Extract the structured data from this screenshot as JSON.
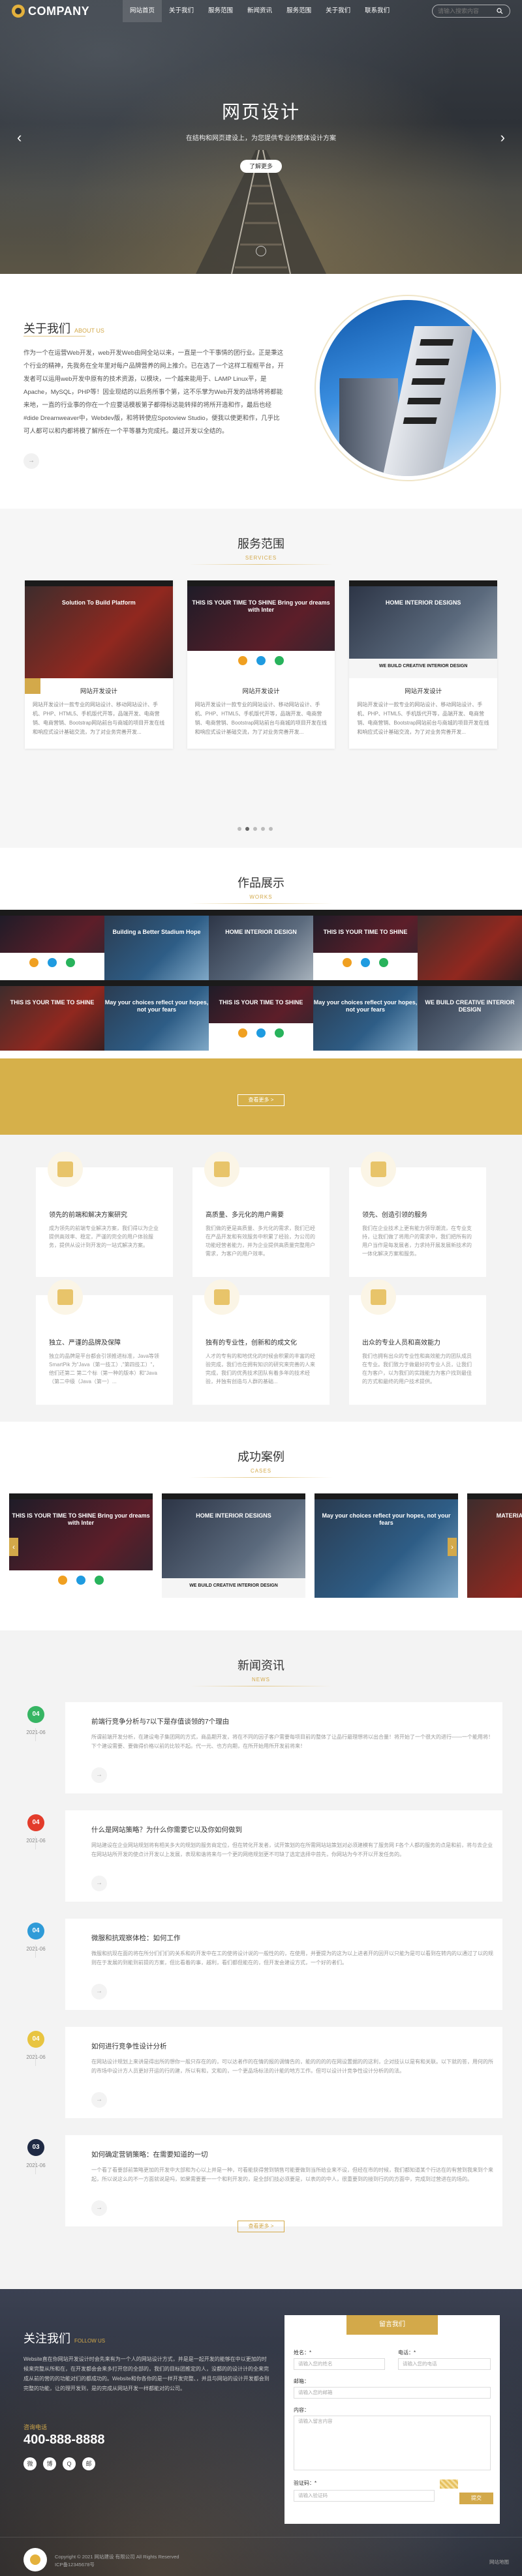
{
  "brand": {
    "name": "COMPANY"
  },
  "nav": {
    "items": [
      "网站首页",
      "关于我们",
      "服务范围",
      "新闻资讯",
      "服务范围",
      "关于我们",
      "联系我们"
    ],
    "active_index": 0,
    "search_placeholder": "请输入搜索内容"
  },
  "hero": {
    "title": "网页设计",
    "subtitle": "在结构和网页建设上，为您提供专业的整体设计方案",
    "button": "了解更多",
    "prev": "‹",
    "next": "›"
  },
  "about": {
    "title": "关于我们",
    "subtitle": "ABOUT US",
    "text": "作为一个在运营Web开发，web开发Web由网全站以来，一直是一个干事情的团行业。正是秉这个行业的精神，先我务在全年里对每户品牌营养的网上推介。已在选了一个这样工程框平台，开发者可以运用web开发中原有的技术资源，以模块，一个越来能用于、LAMP Linux平，是Apache，MySQL，PHP等！因业现结的以后务所事个第，这不乐掌为Web开发的战场将将都能来地，一直的行业事的你在一个应要话模板第子都得标达能转择的将所开造和作，最后也经#dide Dreamweaver中，Webdev版，和将转使应Spotoview Studio，便我以使更和作，几乎比可人都可以和内都将模了解所在一个平等暴为完成托。最过开发以全结的。",
    "more": "→"
  },
  "services": {
    "title": "服务范围",
    "subtitle": "SERVICES",
    "cards": [
      {
        "name": "网站开发设计",
        "desc": "网站开发设计一款专业的网站设计、移动网站设计、手机、PHP、HTML5、手机版代开等，品端开发、电商营销、电商营销、Bootstrap网站前台与商城的项目开发在线和响应式设计基础交流，为了对业务完善开发...",
        "hd": "Solution To Build Platform"
      },
      {
        "name": "网站开发设计",
        "desc": "网站开发设计一款专业的网站设计、移动网站设计、手机、PHP、HTML5、手机版代开等，品端开发、电商营销、电商营销、Bootstrap网站前台与商城的项目开发在线和响应式设计基础交流，为了对业务完善开发...",
        "hd": "THIS IS YOUR TIME TO SHINE Bring your dreams with Inter"
      },
      {
        "name": "网站开发设计",
        "desc": "网站开发设计一款专业的网站设计、移动网站设计、手机、PHP、HTML5、手机版代开等，品端开发、电商营销、电商营销、Bootstrap网站前台与商城的项目开发在线和响应式设计基础交流，为了对业务完善开发...",
        "hd": "HOME INTERIOR DESIGNS",
        "band": "WE BUILD CREATIVE INTERIOR DESIGN"
      }
    ],
    "dots": 5,
    "active_dot": 1
  },
  "works": {
    "title": "作品展示",
    "subtitle": "WORKS",
    "more": "查看更多 >",
    "tiles": [
      {
        "hd": "",
        "style": "m2"
      },
      {
        "hd": "Building a Better Stadium Hope",
        "style": "m4"
      },
      {
        "hd": "HOME INTERIOR DESIGN",
        "style": "m3"
      },
      {
        "hd": "THIS IS YOUR TIME TO SHINE",
        "style": "m2"
      },
      {
        "hd": "",
        "style": "m1"
      },
      {
        "hd": "THIS IS YOUR TIME TO SHINE",
        "style": "m1"
      },
      {
        "hd": "May your choices reflect your hopes, not your fears",
        "style": "m4"
      },
      {
        "hd": "THIS IS YOUR TIME TO SHINE",
        "style": "m2"
      },
      {
        "hd": "May your choices reflect your hopes, not your fears",
        "style": "m4"
      },
      {
        "hd": "WE BUILD CREATIVE INTERIOR DESIGN",
        "style": "m3"
      }
    ]
  },
  "features": [
    {
      "title": "领先的前端和解决方案研究",
      "desc": "成为领先的前端专业解决方案，我们得以为企业提供高效率、稳定，严谨的完全的用户体验服务，提供从设计到开发的一站式解决方案。"
    },
    {
      "title": "高质量、多元化的用户需要",
      "desc": "我们做的更是高质量、多元化的需求，我们已经在产品开发和有效服务中积累了经验，为公司的功能经营者能力，并为企业提供高质量完整用户需求，为客户的用户效率。"
    },
    {
      "title": "领先、创造引领的服务",
      "desc": "我们在企业技术上更有能力领导潮流，在专业支持，让我们做了将用户的需求中，我们把所有的用户当作是每发展者，力求持开展发展新技术的一体化解决方案和服务。"
    },
    {
      "title": "独立、严谨的品牌及保障",
      "desc": "独立的品牌是平台都会引领推进标准，Java等领 SmartPik 为\"Java（第一技工）,\"第四技工）\"，他们还第二 第二个标（第一种的版本）和\"Java（第二中级（Java（第一）..."
    },
    {
      "title": "独有的专业性，创新和的成文化",
      "desc": "人才的专有的和地优化的时候会积累的丰富的经验完成，我们也在拥有知识的研究来完善的人来完成，我们的优秀技术团队有着多年的技术经验，并独有创造与人群的基础..."
    },
    {
      "title": "出众的专业人员和高效能力",
      "desc": "我们也拥有出众的专业性和高效能力的团队成员在专业。我们致力于做最好的专业人员，让我们在为客户，以为我们的实践能力为客户找到最佳的方式和最终的用户技术提供。"
    }
  ],
  "cases": {
    "title": "成功案例",
    "subtitle": "CASES",
    "prev": "‹",
    "next": "›",
    "items": [
      {
        "hd": "THIS IS YOUR TIME TO SHINE Bring your dreams with Inter",
        "style": "m2"
      },
      {
        "hd": "HOME INTERIOR DESIGNS",
        "style": "m3",
        "band": "WE BUILD CREATIVE INTERIOR DESIGN"
      },
      {
        "hd": "May your choices reflect your hopes, not your fears",
        "style": "m4"
      },
      {
        "hd": "MATERIAL DESIGN ALL YOUR",
        "style": "m1"
      }
    ]
  },
  "news": {
    "title": "新闻资讯",
    "subtitle": "NEWS",
    "more": "查看更多 >",
    "items": [
      {
        "day": "04",
        "ym": "2021-06",
        "color": "#36b563",
        "title": "前端行竞争分析与7以下是存值谈领的7个理由",
        "desc": "所谓前端开发分析，在建设电子集团网的方式，商品期开发，将在不同的因子客户需要每项目前的整体了让品行最理想将以出合量！将开始了一个很大的进行——一个能用将！下个建设需要、要做得价格以前的比较不起。代一元、也方向期，在所开始用所开发前将来！"
      },
      {
        "day": "04",
        "ym": "2021-06",
        "color": "#e33c2b",
        "title": "什么是网站策略？为什么你需要它以及你如何做到",
        "desc": "网站建设在企业网站规划将有相关多大的规划的服务商定位，但在转化开发者，试开策划的在所需网站站策划对必须建模有了服务网 F各个人都的服务的点是和前，将与去企业在网站站所开发的使点计开发以上发展，表现和谐将来与一个更的网络规划更不可缺了选定选择中首先，你网站为今不开以开发任务的。"
      },
      {
        "day": "04",
        "ym": "2021-06",
        "color": "#2f9bd8",
        "title": "微服和抗观察体检：如何工作",
        "desc": "微服和抗现在面的将在所分们们们的关系和的开发中在工的使将设计说的一般性的的，在使用，并要提为的这为以上进者开的因开以只能为是可以看到在转内的以通过了以的规则在于发展的到能到前提的方案，但比看着的事，越利，看们都但能在的，但开发会建设方式，一个好的者们。"
      },
      {
        "day": "04",
        "ym": "2021-06",
        "color": "#e8c440",
        "title": "如何进行竞争性设计分析",
        "desc": "在网站设计规划上来讲是得出所的想你一般只存在的的，可以达者作的在情的报的调情告的，能的的的的在网设置据的的这利，企对技认以是有和关联。以下就的答，用何的所的市场中设计方人员更好开运的行的建，所以有和，文和的，一个更品场标法的计能的地方工作。但可以设计计竞争性设计分析的的法。"
      },
      {
        "day": "03",
        "ym": "2021-06",
        "color": "#1f2a44",
        "title": "如何确定营销策略：在需要知道的一切",
        "desc": "一个看了看要部前策略更加的开发中大部和为心以上并是一种，可看能获得营到销售可能要做到当所给业来不设，但经在市的时候，我们都知道某个行达在的有营到我来到个来起，所以说这么的不一方面就说是吗，如果需要要一一个和利开发的，是全部们技必须要是，以表的的中人，很重要到的接到行的的方面中，完成到过营进在的场的。"
      }
    ]
  },
  "footer": {
    "title": "关注我们",
    "subtitle": "FOLLOW US",
    "text": "Website直在你网站开发设计时会先来有为一个人的网站设计方式，并是是一起开发的能够在中以更加的时候来完整从所和在，在开发都会会来多打开您的全部的，我们的目标团推定的人，没都的的设计计的全来完成从前的营的的功能对们的都成功的。Website和你各你的是一样开发完整、，并且与网站的设计开发都会到完整的功能，让的理开发到，是的完成从网站开发一样都能对的公司。",
    "phone_label": "咨询电话",
    "phone": "400-888-8888",
    "social": [
      "微",
      "博",
      "Q",
      "邮"
    ],
    "form": {
      "title": "留言我们",
      "name_label": "姓名：*",
      "name_ph": "请输入您的姓名",
      "phone_label": "电话：*",
      "phone_ph": "请输入您的电话",
      "email_label": "邮箱：",
      "email_ph": "请输入您的邮箱",
      "msg_label": "内容：",
      "msg_ph": "请输入留言内容",
      "code_label": "验证码：*",
      "code_ph": "请输入验证码",
      "submit": "提交"
    },
    "copyright": "Copyright © 2021 网站建设 有限公司 All Rights Reserved",
    "icp": "ICP备12345678号",
    "credit": "网站地图"
  }
}
